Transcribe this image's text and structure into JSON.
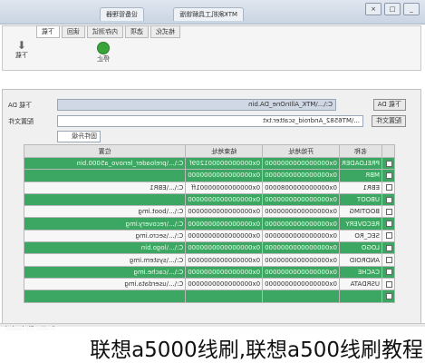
{
  "window": {
    "tabs": [
      "MTK刷机工具解锁版",
      "设备管理器"
    ],
    "controls": [
      "_",
      "□",
      "×"
    ]
  },
  "toolbar": {
    "tabs": [
      "下载",
      "读回",
      "内存测试",
      "选项",
      "格式化"
    ],
    "download_label": "下载",
    "stop_label": "停止"
  },
  "form": {
    "da_label": "下载 DA",
    "da_value": "C:\\...\\MTK_AllInOne_DA.bin",
    "scatter_label": "配置文件",
    "scatter_value": "...\\MT6582_Android_scatter.txt",
    "da_button": "下载 DA",
    "scatter_button": "配置文件",
    "mode_value": "固件升级"
  },
  "grid": {
    "headers": [
      "",
      "名称",
      "开始地址",
      "结束地址",
      "位置"
    ],
    "rows": [
      {
        "name": "PRELOADER",
        "start": "0x0000000000000000",
        "end": "0x000000000001209f",
        "path": "C:\\...\\preloader_lenovo_a5000.bin",
        "green": true
      },
      {
        "name": "MBR",
        "start": "0x0000000000000000",
        "end": "0x0000000000000000",
        "path": "",
        "green": true
      },
      {
        "name": "EBR1",
        "start": "0x0000000000080000",
        "end": "0x00000000000001ff",
        "path": "C:\\...\\EBR1",
        "green": false
      },
      {
        "name": "UBOOT",
        "start": "0x0000000000000000",
        "end": "0x0000000000000000",
        "path": "",
        "green": true
      },
      {
        "name": "BOOTIMG",
        "start": "0x0000000000000000",
        "end": "0x0000000000000000",
        "path": "C:\\...\\boot.img",
        "green": false
      },
      {
        "name": "RECOVERY",
        "start": "0x0000000000000000",
        "end": "0x0000000000000000",
        "path": "C:\\...\\recovery.img",
        "green": true
      },
      {
        "name": "SEC_RO",
        "start": "0x0000000000000000",
        "end": "0x0000000000000000",
        "path": "C:\\...\\secro.img",
        "green": false
      },
      {
        "name": "LOGO",
        "start": "0x0000000000000000",
        "end": "0x0000000000000000",
        "path": "C:\\...\\logo.bin",
        "green": true
      },
      {
        "name": "ANDROID",
        "start": "0x0000000000000000",
        "end": "0x0000000000000000",
        "path": "C:\\...\\system.img",
        "green": false
      },
      {
        "name": "CACHE",
        "start": "0x0000000000000000",
        "end": "0x0000000000000000",
        "path": "C:\\...\\cache.img",
        "green": true
      },
      {
        "name": "USRDATA",
        "start": "0x0000000000000000",
        "end": "0x0000000000000000",
        "path": "C:\\...\\userdata.img",
        "green": false
      },
      {
        "name": "",
        "start": "",
        "end": "",
        "path": "",
        "green": true
      }
    ]
  },
  "status": "Scatter file loaded",
  "caption": "联想a5000线刷,联想a500线刷教程"
}
